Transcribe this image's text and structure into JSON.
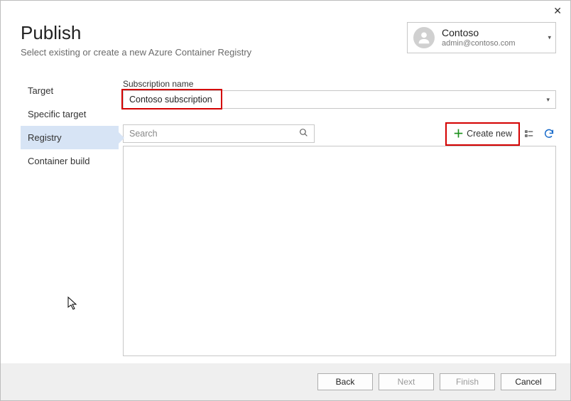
{
  "header": {
    "title": "Publish",
    "subtitle": "Select existing or create a new Azure Container Registry"
  },
  "account": {
    "name": "Contoso",
    "email": "admin@contoso.com"
  },
  "sidebar": {
    "items": [
      {
        "label": "Target"
      },
      {
        "label": "Specific target"
      },
      {
        "label": "Registry"
      },
      {
        "label": "Container build"
      }
    ]
  },
  "content": {
    "subscription_label": "Subscription name",
    "subscription_value": "Contoso subscription",
    "search_placeholder": "Search",
    "create_new_label": "Create new"
  },
  "footer": {
    "back": "Back",
    "next": "Next",
    "finish": "Finish",
    "cancel": "Cancel"
  }
}
